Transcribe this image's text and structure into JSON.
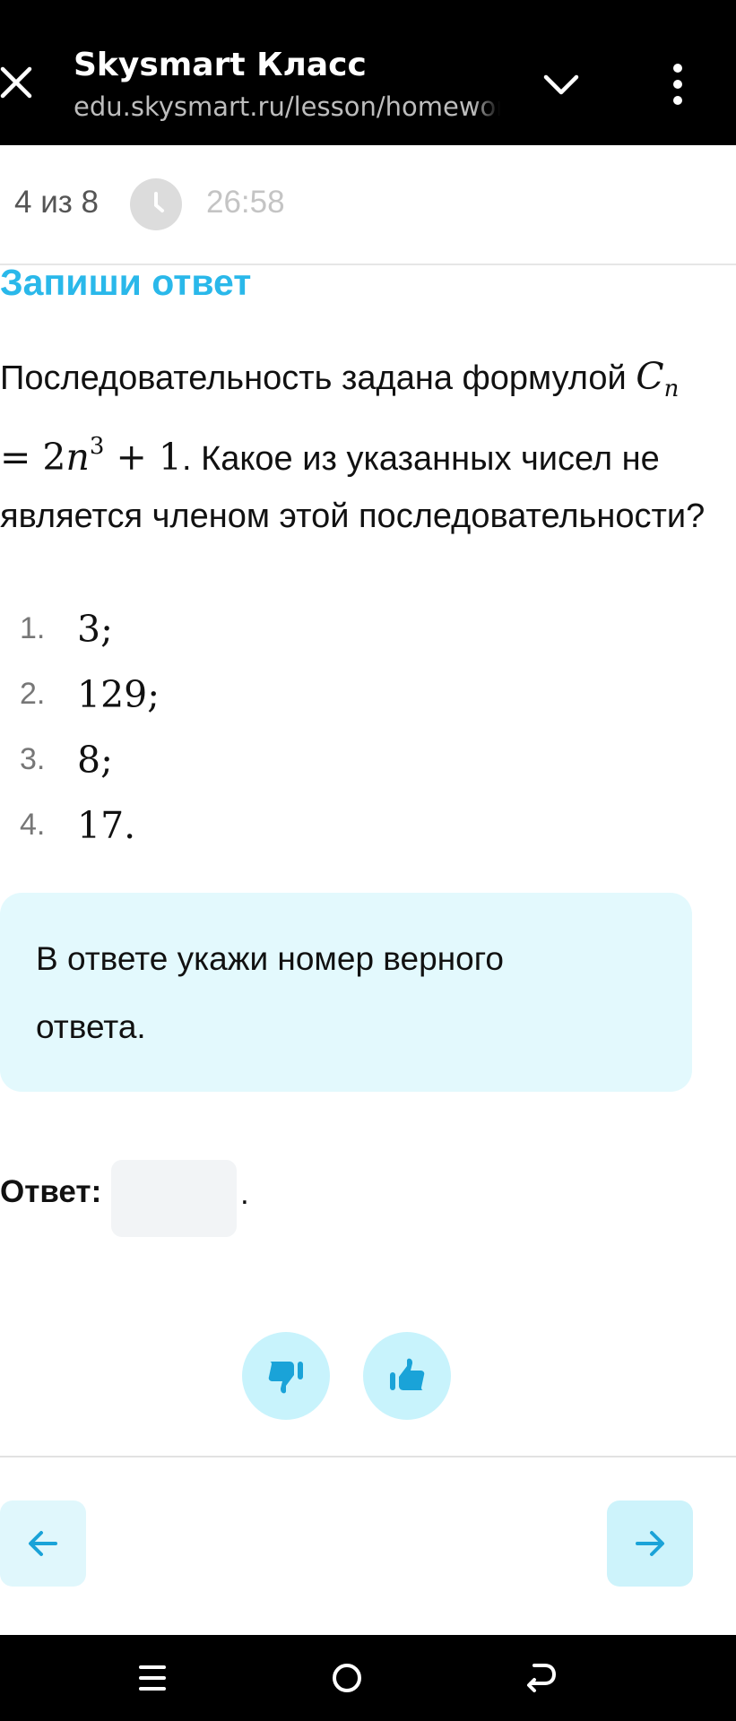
{
  "browser": {
    "title": "Skysmart Класс",
    "url": "edu.skysmart.ru/lesson/homework"
  },
  "progress": {
    "counter": "4 из 8",
    "timer": "26:58"
  },
  "task": {
    "heading": "Запиши ответ",
    "question_before": "Последовательность задана формулой",
    "question_after": ". Какое из указанных чисел не является членом этой последовательности?",
    "formula": {
      "base": "C",
      "subscript": "n",
      "equals": "= 2",
      "var": "n",
      "power": "3",
      "tail": "+ 1"
    },
    "options": [
      {
        "number": "1.",
        "value": "3;"
      },
      {
        "number": "2.",
        "value": "129;"
      },
      {
        "number": "3.",
        "value": "8;"
      },
      {
        "number": "4.",
        "value": "17."
      }
    ],
    "hint": "В ответе укажи номер верного ответа.",
    "answer_label": "Ответ:",
    "answer_value": "",
    "answer_suffix": "."
  },
  "colors": {
    "accent": "#2ab8ea",
    "hint_bg": "#e3f9fd",
    "rate_bg": "#c8f3fc",
    "icon_blue": "#1aa3d8"
  },
  "icons": {
    "close": "close-icon",
    "chevron": "chevron-down-icon",
    "menu": "kebab-menu-icon",
    "clock": "clock-icon",
    "dislike": "thumbs-down-icon",
    "like": "thumbs-up-icon",
    "prev": "arrow-left-icon",
    "next": "arrow-right-icon"
  }
}
